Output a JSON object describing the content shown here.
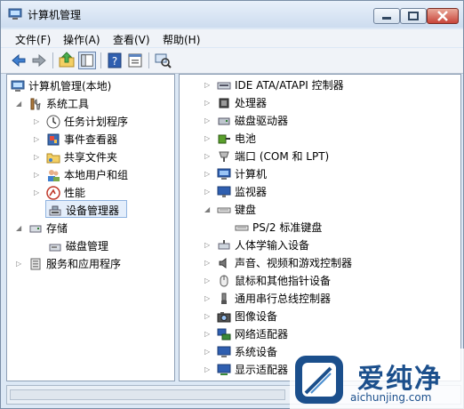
{
  "window": {
    "title": "计算机管理",
    "controls": {
      "minimize": "min-icon",
      "maximize": "max-icon",
      "close": "close-icon"
    }
  },
  "menu": [
    "文件(F)",
    "操作(A)",
    "查看(V)",
    "帮助(H)"
  ],
  "toolbar_icons": [
    "back-arrow-icon",
    "forward-arrow-icon",
    "up-folder-icon",
    "show-hide-tree-icon",
    "help-icon",
    "properties-icon",
    "scan-hardware-icon"
  ],
  "left_tree": {
    "root": "计算机管理(本地)",
    "system_tools": "系统工具",
    "task_scheduler": "任务计划程序",
    "event_viewer": "事件查看器",
    "shared_folders": "共享文件夹",
    "local_users": "本地用户和组",
    "performance": "性能",
    "device_manager": "设备管理器",
    "storage": "存储",
    "disk_management": "磁盘管理",
    "services_apps": "服务和应用程序"
  },
  "devices": [
    "IDE ATA/ATAPI 控制器",
    "处理器",
    "磁盘驱动器",
    "电池",
    "端口 (COM 和 LPT)",
    "计算机",
    "监视器",
    "键盘",
    "PS/2 标准键盘",
    "人体学输入设备",
    "声音、视频和游戏控制器",
    "鼠标和其他指针设备",
    "通用串行总线控制器",
    "图像设备",
    "网络适配器",
    "系统设备",
    "显示适配器"
  ],
  "watermark": {
    "title": "爱纯净",
    "url": "aichunjing.com"
  }
}
